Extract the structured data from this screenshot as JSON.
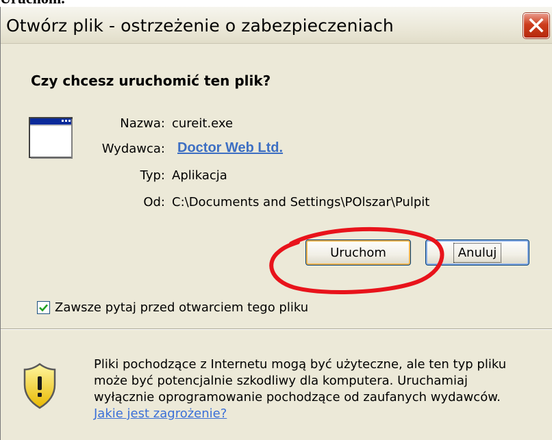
{
  "heading_crop": "Uruchom.",
  "window": {
    "title": "Otwórz plik - ostrzeżenie o zabezpieczeniach"
  },
  "question": "Czy chcesz uruchomić ten plik?",
  "file_info": {
    "name_label": "Nazwa:",
    "name_value": "cureit.exe",
    "publisher_label": "Wydawca:",
    "publisher_value": "Doctor Web Ltd.",
    "type_label": "Typ:",
    "type_value": "Aplikacja",
    "from_label": "Od:",
    "from_value": "C:\\Documents and Settings\\POlszar\\Pulpit"
  },
  "buttons": {
    "run_label": "Uruchom",
    "cancel_label": "Anuluj"
  },
  "checkbox": {
    "label": "Zawsze pytaj przed otwarciem tego pliku",
    "checked": true
  },
  "warning": {
    "line1": "Pliki pochodzące z Internetu mogą być użyteczne, ale ten typ pliku",
    "line2": "może być potencjalnie szkodliwy dla komputera. Uruchamiaj",
    "line3": "wyłącznie oprogramowanie pochodzące od zaufanych wydawców.",
    "link": "Jakie jest zagrożenie?"
  },
  "colors": {
    "dialog_bg": "#ece9d8",
    "link": "#3d6fc3",
    "annotation": "#e8131b",
    "close_button": "#cd3d1d"
  },
  "icons": [
    "application-file-icon",
    "close-icon",
    "checkmark-icon",
    "security-shield-icon"
  ]
}
